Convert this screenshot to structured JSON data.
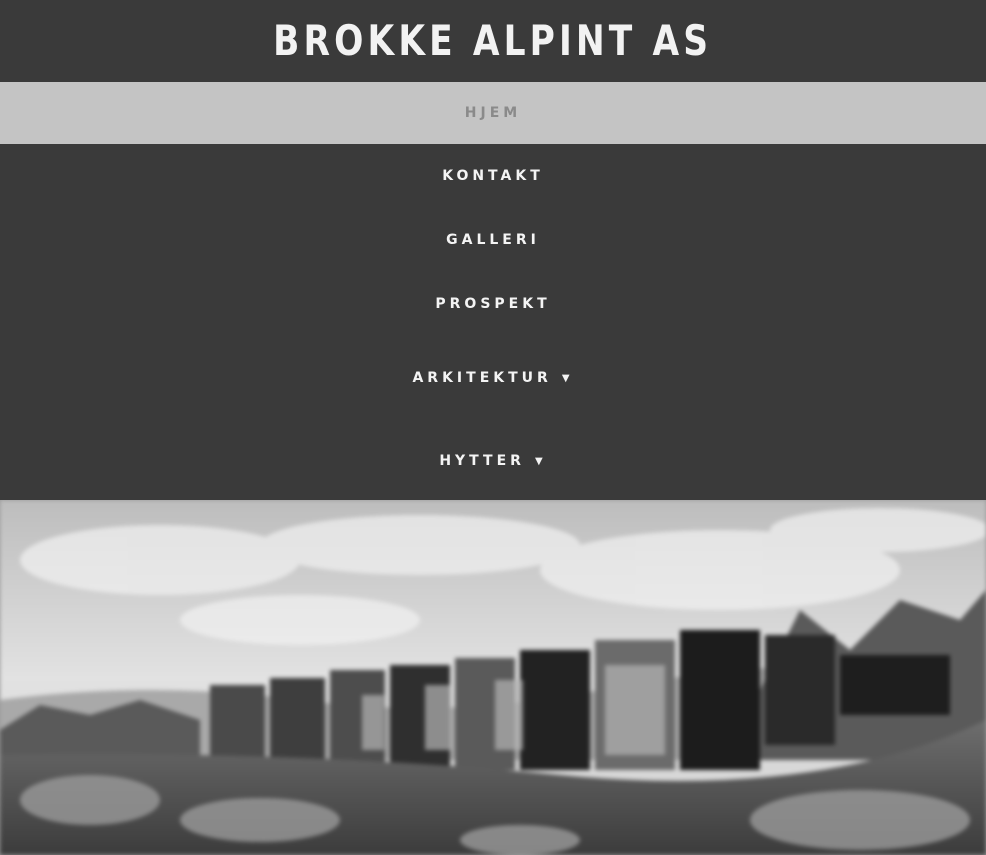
{
  "site": {
    "title": "BROKKE ALPINT AS"
  },
  "nav": {
    "items": [
      {
        "label": "HJEM",
        "active": true
      },
      {
        "label": "KONTAKT"
      },
      {
        "label": "GALLERI"
      },
      {
        "label": "PROSPEKT"
      },
      {
        "label": "ARKITEKTUR",
        "has_dropdown": true
      },
      {
        "label": "HYTTER",
        "has_dropdown": true
      }
    ],
    "dropdown_icon": "chevron-down-icon"
  },
  "hero": {
    "image": "black-and-white photo of a row of cabins on a hillside under a cloudy sky"
  },
  "colors": {
    "header_bg": "#3a3a3a",
    "active_nav_bg": "#c4c4c4",
    "active_nav_text": "#8a8a8a",
    "nav_text": "#f4f4f4"
  }
}
